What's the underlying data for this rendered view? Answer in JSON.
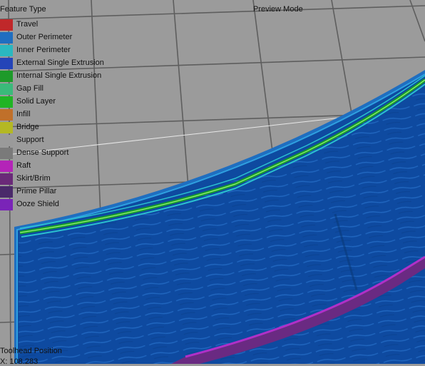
{
  "legend": {
    "title": "Feature Type",
    "items": [
      {
        "label": "Travel",
        "color": "#c0282a"
      },
      {
        "label": "Outer Perimeter",
        "color": "#1f6ec0"
      },
      {
        "label": "Inner Perimeter",
        "color": "#2ab8c0"
      },
      {
        "label": "External Single Extrusion",
        "color": "#2444b8"
      },
      {
        "label": "Internal Single Extrusion",
        "color": "#1e9a2a"
      },
      {
        "label": "Gap Fill",
        "color": "#3aba7a"
      },
      {
        "label": "Solid Layer",
        "color": "#20b424"
      },
      {
        "label": "Infill",
        "color": "#c0702a"
      },
      {
        "label": "Bridge",
        "color": "#b4b824"
      },
      {
        "label": "Support",
        "color": "#9a9a9a"
      },
      {
        "label": "Dense Support",
        "color": "#7a7a7a"
      },
      {
        "label": "Raft",
        "color": "#b424b8"
      },
      {
        "label": "Skirt/Brim",
        "color": "#6a2a78"
      },
      {
        "label": "Prime Pillar",
        "color": "#4a2a6a"
      },
      {
        "label": "Ooze Shield",
        "color": "#7a24b8"
      }
    ]
  },
  "header": {
    "mode_label": "Preview Mode"
  },
  "toolhead": {
    "label": "Toolhead Position",
    "value": "X: 108.283"
  }
}
